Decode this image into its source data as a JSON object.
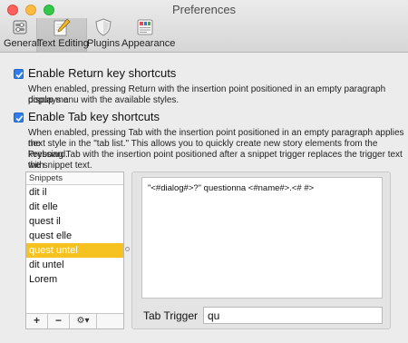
{
  "window": {
    "title": "Preferences"
  },
  "toolbar": {
    "tabs": [
      {
        "label": "General",
        "icon": "switch-icon"
      },
      {
        "label": "Text Editing",
        "icon": "pencil-icon",
        "selected": true
      },
      {
        "label": "Plugins",
        "icon": "shield-icon"
      },
      {
        "label": "Appearance",
        "icon": "palette-icon"
      }
    ]
  },
  "options": {
    "return_label": "Enable Return key shortcuts",
    "return_checked": true,
    "return_desc_1": "When enabled, pressing Return with the insertion point positioned in an empty paragraph displays a",
    "return_desc_2": "popup menu with the available styles.",
    "tab_label": "Enable Tab key shortcuts",
    "tab_checked": true,
    "tab_desc_1": "When enabled, pressing Tab with the insertion point positioned in an empty paragraph applies the",
    "tab_desc_2": "next style in the \"tab list.\" This allows you to quickly create new story elements from the keyboard.",
    "tab_desc_3": "Pressing Tab with the insertion point positioned after a snippet trigger replaces the trigger text with",
    "tab_desc_4": "the snippet text."
  },
  "snippets": {
    "header": "Snippets",
    "items": [
      "dit il",
      "dit elle",
      "quest il",
      "quest elle",
      "quest untel",
      "dit untel",
      "Lorem"
    ],
    "selected_index": 4,
    "add_label": "+",
    "remove_label": "−",
    "action_label": "⚙▾"
  },
  "editor": {
    "text": "\"<#dialog#>?\" questionna <#name#>.<# #>"
  },
  "trigger": {
    "label": "Tab Trigger",
    "value": "qu"
  },
  "colors": {
    "selection": "#f5c21f",
    "checkbox": "#2f7dec"
  }
}
